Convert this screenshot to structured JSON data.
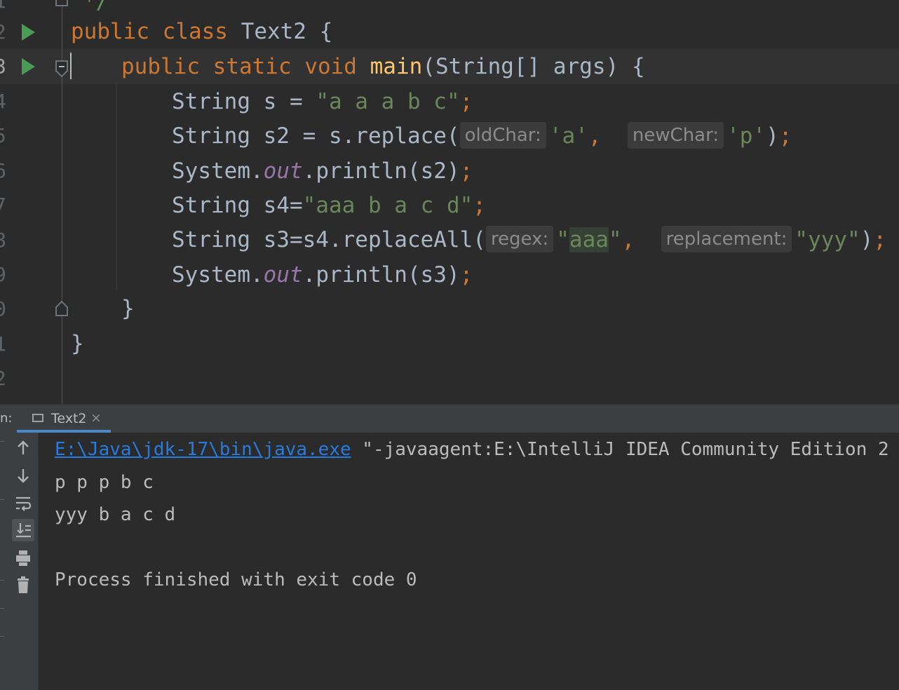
{
  "editor": {
    "line_numbers": [
      "1",
      "2",
      "3",
      "4",
      "5",
      "6",
      "7",
      "8",
      "9",
      "0",
      "1",
      "2"
    ],
    "top_comment": "*/",
    "line2": {
      "kw1": "public",
      "kw2": "class",
      "name": "Text2",
      "brace": "{"
    },
    "line3": {
      "kw1": "public",
      "kw2": "static",
      "kw3": "void",
      "method": "main",
      "params": "(String[] args)",
      "brace": "{"
    },
    "line4": {
      "decl": "String s = ",
      "value": "\"a a a b c\"",
      "semi": ";"
    },
    "line5": {
      "decl": "String s2 = s.replace(",
      "hint1": "oldChar:",
      "arg1": "'a'",
      "comma": ",",
      "hint2": "newChar:",
      "arg2": "'p'",
      "close": ")",
      "semi": ";"
    },
    "line6": {
      "pre": "System.",
      "field": "out",
      "post": ".println(s2)",
      "semi": ";"
    },
    "line7": {
      "decl": "String s4=",
      "value": "\"aaa b a c d\"",
      "semi": ";"
    },
    "line8": {
      "decl": "String s3=s4.replaceAll(",
      "hint1": "regex:",
      "q1": "\"",
      "arg1": "aaa",
      "q2": "\"",
      "comma": ",",
      "hint2": "replacement:",
      "arg2": "\"yyy\"",
      "close": ")",
      "semi": ";"
    },
    "line9": {
      "pre": "System.",
      "field": "out",
      "post": ".println(s3)",
      "semi": ";"
    },
    "line10": {
      "brace": "}"
    },
    "line11": {
      "brace": "}"
    }
  },
  "run_panel": {
    "label": "n:",
    "tab_label": "Text2",
    "tab_close": "×",
    "toolbar_icons": [
      "up-arrow-icon",
      "down-arrow-icon",
      "soft-wrap-icon",
      "scroll-to-end-icon",
      "print-icon",
      "trash-icon"
    ],
    "console": {
      "cmd_link": "E:\\Java\\jdk-17\\bin\\java.exe",
      "cmd_rest": " \"-javaagent:E:\\IntelliJ IDEA Community Edition 2",
      "output1": "p p p b c",
      "output2": "yyy b a c d",
      "exit": "Process finished with exit code 0"
    }
  },
  "colors": {
    "keyword": "#cc7832",
    "string": "#6a8759",
    "method": "#ffc66d",
    "field": "#9876aa",
    "link": "#287bde",
    "run": "#499c54"
  }
}
